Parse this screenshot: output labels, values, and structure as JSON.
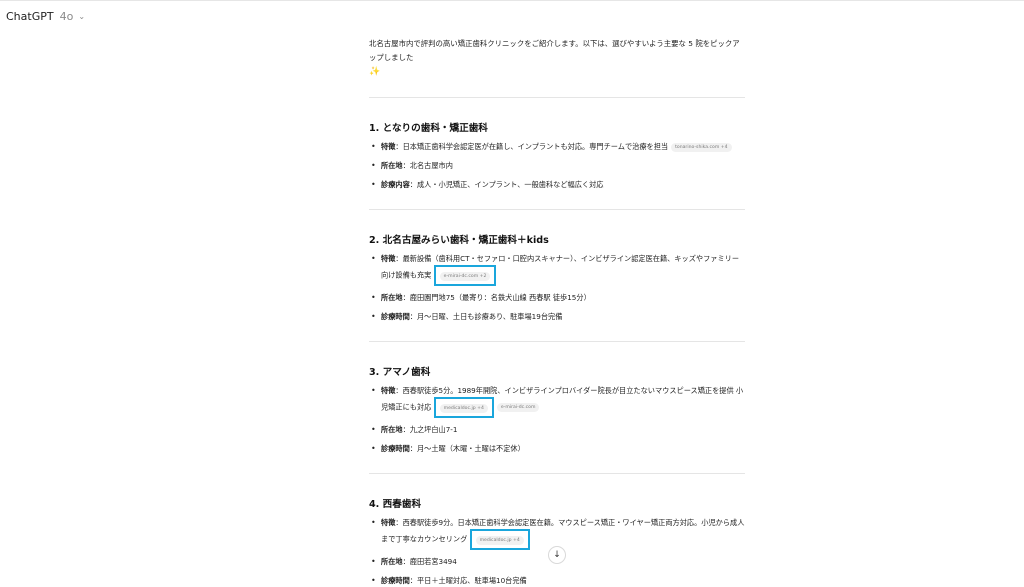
{
  "header": {
    "model_name": "ChatGPT",
    "model_version": "4o"
  },
  "intro": "北名古屋市内で評判の高い矯正歯科クリニックをご紹介します。以下は、選びやすいよう主要な 5 院をピックアップしました",
  "sections": [
    {
      "title": "1. となりの歯科・矯正歯科",
      "items": [
        {
          "label": "特徴",
          "text": "：日本矯正歯科学会認定医が在籍し、インプラントも対応。専門チームで治療を担当",
          "cite": "tonarino-shika.com +4"
        },
        {
          "label": "所在地",
          "text": "：北名古屋市内"
        },
        {
          "label": "診療内容",
          "text": "：成人・小児矯正、インプラント、一般歯科など幅広く対応"
        }
      ]
    },
    {
      "title": "2. 北名古屋みらい歯科・矯正歯科＋kids",
      "items": [
        {
          "label": "特徴",
          "text": "：最新設備（歯科用CT・セファロ・口腔内スキャナー）、インビザライン認定医在籍、キッズやファミリー向け設備も充実",
          "cite": "e-mirai-dc.com +2"
        },
        {
          "label": "所在地",
          "text": "：鹿田園門地75（最寄り：名鉄犬山線 西春駅 徒歩15分）"
        },
        {
          "label": "診療時間",
          "text": "：月〜日曜、土日も診療あり、駐車場19台完備"
        }
      ]
    },
    {
      "title": "3. アマノ歯科",
      "items": [
        {
          "label": "特徴",
          "text": "：西春駅徒歩5分。1989年開院、インビザラインプロバイダー院長が目立たないマウスピース矯正を提供 小児矯正にも対応",
          "cite": "medicaldoc.jp +4",
          "cite2": "e-mirai-dc.com"
        },
        {
          "label": "所在地",
          "text": "：九之坪白山7-1"
        },
        {
          "label": "診療時間",
          "text": "：月〜土曜（木曜・土曜は不定休）"
        }
      ]
    },
    {
      "title": "4. 西春歯科",
      "items": [
        {
          "label": "特徴",
          "text": "：西春駅徒歩9分。日本矯正歯科学会認定医在籍。マウスピース矯正・ワイヤー矯正両方対応。小児から成人まで丁寧なカウンセリング",
          "cite": "medicaldoc.jp +4"
        },
        {
          "label": "所在地",
          "text": "：鹿田若宮3494"
        },
        {
          "label": "診療時間",
          "text": "：平日＋土曜対応、駐車場10台完備"
        }
      ]
    }
  ],
  "highlight_color": "#1aa6dc",
  "icons": {
    "model_chevron": "chevron-down-icon",
    "spark": "sparkles-icon",
    "scroll": "arrow-down-icon"
  },
  "glyphs": {
    "chevron": "⌄",
    "spark": "✨",
    "scroll_arrow": "↓"
  }
}
